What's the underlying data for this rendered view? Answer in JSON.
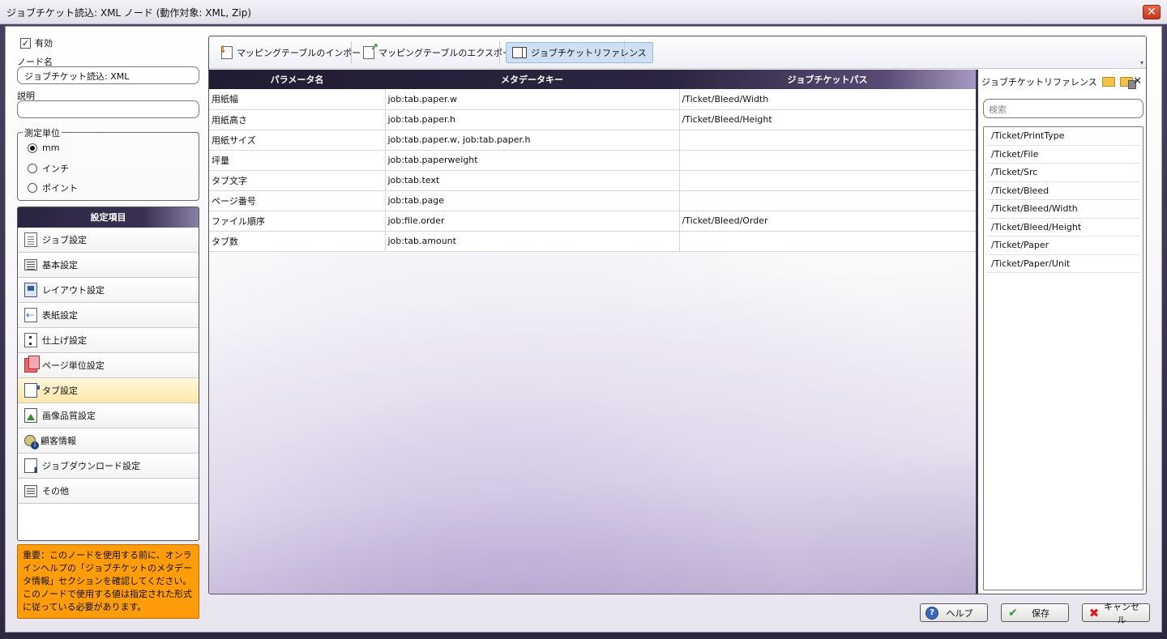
{
  "window": {
    "title": "ジョブチケット読込: XML ノード (動作対象: XML, Zip)",
    "close_icon": "close-icon"
  },
  "left": {
    "enabled_label": "有効",
    "enabled_checked": true,
    "node_name_label": "ノード名",
    "node_name_value": "ジョブチケット読込: XML",
    "description_label": "説明",
    "description_value": "",
    "units_label": "測定単位",
    "units": [
      {
        "label": "mm",
        "selected": true
      },
      {
        "label": "インチ",
        "selected": false
      },
      {
        "label": "ポイント",
        "selected": false
      }
    ],
    "settings_header": "設定項目",
    "settings": [
      {
        "label": "ジョブ設定",
        "icon": "job-settings-icon",
        "active": false
      },
      {
        "label": "基本設定",
        "icon": "basic-settings-icon",
        "active": false
      },
      {
        "label": "レイアウト設定",
        "icon": "layout-settings-icon",
        "active": false
      },
      {
        "label": "表紙設定",
        "icon": "cover-settings-icon",
        "active": false
      },
      {
        "label": "仕上げ設定",
        "icon": "finishing-settings-icon",
        "active": false
      },
      {
        "label": "ページ単位設定",
        "icon": "page-settings-icon",
        "active": false
      },
      {
        "label": "タブ設定",
        "icon": "tab-settings-icon",
        "active": true
      },
      {
        "label": "画像品質設定",
        "icon": "image-quality-icon",
        "active": false
      },
      {
        "label": "顧客情報",
        "icon": "customer-info-icon",
        "active": false
      },
      {
        "label": "ジョブダウンロード設定",
        "icon": "job-download-icon",
        "active": false
      },
      {
        "label": "その他",
        "icon": "other-settings-icon",
        "active": false
      }
    ],
    "warning": "重要：このノードを使用する前に、オンラインヘルプの「ジョブチケットのメタデータ情報」セクションを確認してください。このノードで使用する値は指定された形式に従っている必要があります。"
  },
  "toolbar": {
    "import_label": "マッピングテーブルのインポート",
    "export_label": "マッピングテーブルのエクスポート",
    "reference_label": "ジョブチケットリファレンス"
  },
  "grid": {
    "columns": [
      "パラメータ名",
      "メタデータキー",
      "ジョブチケットパス"
    ],
    "rows": [
      [
        "用紙幅",
        "job:tab.paper.w",
        "/Ticket/Bleed/Width"
      ],
      [
        "用紙高さ",
        "job:tab.paper.h",
        "/Ticket/Bleed/Height"
      ],
      [
        "用紙サイズ",
        "job:tab.paper.w, job:tab.paper.h",
        ""
      ],
      [
        "坪量",
        "job:tab.paperweight",
        ""
      ],
      [
        "タブ文字",
        "job:tab.text",
        ""
      ],
      [
        "ページ番号",
        "job:tab.page",
        ""
      ],
      [
        "ファイル順序",
        "job:file.order",
        "/Ticket/Bleed/Order"
      ],
      [
        "タブ数",
        "job:tab.amount",
        ""
      ]
    ]
  },
  "reference": {
    "title": "ジョブチケットリファレンス",
    "search_placeholder": "検索",
    "items": [
      "/Ticket/PrintType",
      "/Ticket/File",
      "/Ticket/Src",
      "/Ticket/Bleed",
      "/Ticket/Bleed/Width",
      "/Ticket/Bleed/Height",
      "/Ticket/Paper",
      "/Ticket/Paper/Unit"
    ]
  },
  "buttons": {
    "help": "ヘルプ",
    "save": "保存",
    "cancel": "キャンセル"
  },
  "colors": {
    "accent_warning": "#ff9c0a",
    "header_dark": "#221c33",
    "active_item": "#ffe8a8"
  }
}
